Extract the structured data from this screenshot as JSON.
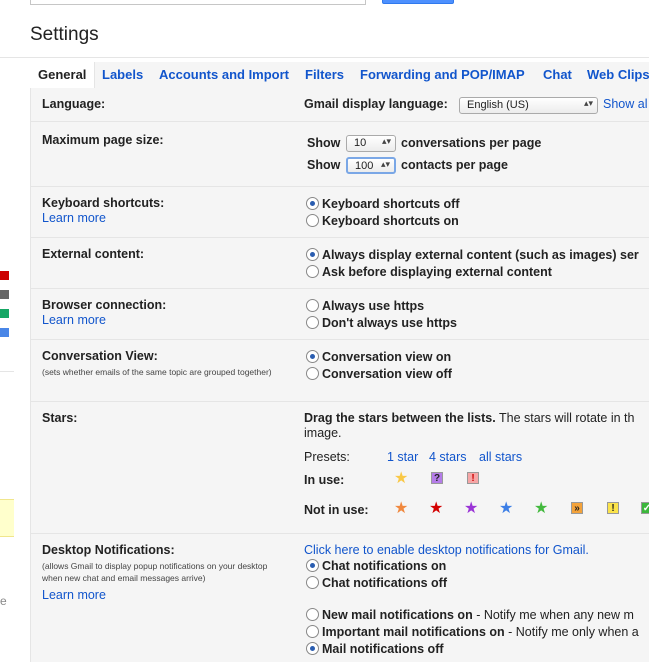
{
  "page": {
    "title": "Settings"
  },
  "tabs": [
    "General",
    "Labels",
    "Accounts and Import",
    "Filters",
    "Forwarding and POP/IMAP",
    "Chat",
    "Web Clips"
  ],
  "language": {
    "label": "Language:",
    "display_label": "Gmail display language:",
    "value": "English (US)",
    "show_link": "Show al"
  },
  "page_size": {
    "label": "Maximum page size:",
    "show": "Show",
    "conversations_value": "10",
    "conversations_text": "conversations per page",
    "contacts_value": "100",
    "contacts_text": "contacts per page"
  },
  "keyboard": {
    "label": "Keyboard shortcuts:",
    "learn_more": "Learn more",
    "off": "Keyboard shortcuts off",
    "on": "Keyboard shortcuts on",
    "selected": "off"
  },
  "external": {
    "label": "External content:",
    "always": "Always display external content (such as images) ser",
    "ask": "Ask before displaying external content"
  },
  "browser": {
    "label": "Browser connection:",
    "learn_more": "Learn more",
    "https": "Always use https",
    "no_https": "Don't always use https"
  },
  "conversation": {
    "label": "Conversation View:",
    "note": "(sets whether emails of the same topic are grouped together)",
    "on": "Conversation view on",
    "off": "Conversation view off"
  },
  "stars": {
    "label": "Stars:",
    "intro_bold": "Drag the stars between the lists.",
    "intro_rest": "  The stars will rotate in th",
    "intro_line2": "image.",
    "presets_label": "Presets:",
    "presets": [
      "1 star",
      "4 stars",
      "all stars"
    ],
    "in_use_label": "In use:",
    "not_in_use_label": "Not in use:",
    "in_use_icons": [
      "yellow-star",
      "purple-question",
      "red-bang"
    ],
    "not_in_use_icons": [
      "orange-star",
      "red-star",
      "purple-star",
      "blue-star",
      "green-star",
      "orange-guillemet",
      "yellow-bang",
      "green-check"
    ]
  },
  "desktop": {
    "label": "Desktop Notifications:",
    "note": "(allows Gmail to display popup notifications on your desktop when new chat and email messages arrive)",
    "learn_more": "Learn more",
    "enable_link": "Click here to enable desktop notifications for Gmail.",
    "chat_on": "Chat notifications on",
    "chat_off": "Chat notifications off",
    "new_mail_bold": "New mail notifications on",
    "new_mail_rest": " - Notify me when any new m",
    "important_bold": "Important mail notifications on",
    "important_rest": " - Notify me only when a",
    "mail_off": "Mail notifications off"
  },
  "left_edge": {
    "fragment": "e"
  },
  "colors": {
    "link": "#1155cc",
    "panel": "#f5f5f5",
    "label_red": "#cc0000",
    "label_gray": "#666666",
    "label_green": "#16a765",
    "label_blue": "#4986e7"
  }
}
